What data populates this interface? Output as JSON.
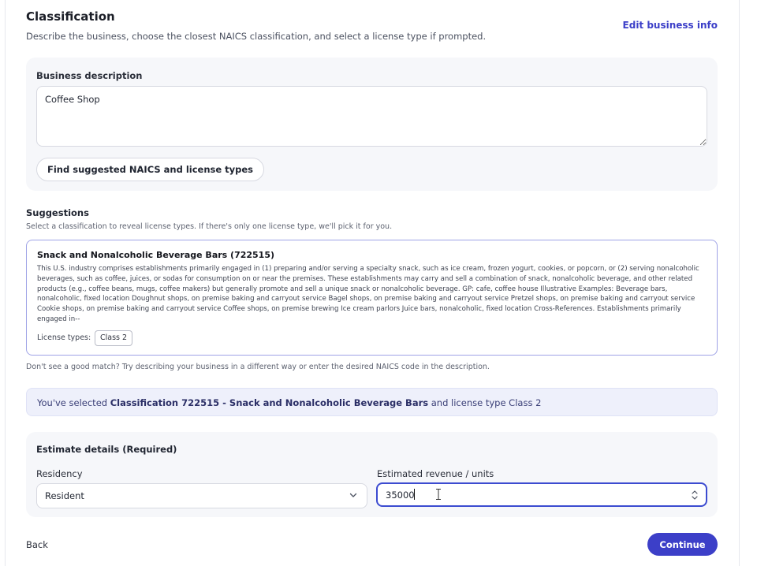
{
  "header": {
    "title": "Classification",
    "subtitle": "Describe the business, choose the closest NAICS classification, and select a license type if prompted.",
    "edit_link": "Edit business info"
  },
  "description": {
    "label": "Business description",
    "value": "Coffee Shop",
    "find_button": "Find suggested NAICS and license types"
  },
  "suggestions": {
    "title": "Suggestions",
    "hint": "Select a classification to reveal license types. If there's only one license type, we'll pick it for you.",
    "items": [
      {
        "name": "Snack and Nonalcoholic Beverage Bars (722515)",
        "description": "This U.S. industry comprises establishments primarily engaged in (1) preparing and/or serving a specialty snack, such as ice cream, frozen yogurt, cookies, or popcorn, or (2) serving nonalcoholic beverages, such as coffee, juices, or sodas for consumption on or near the premises. These establishments may carry and sell a combination of snack, nonalcoholic beverage, and other related products (e.g., coffee beans, mugs, coffee makers) but generally promote and sell a unique snack or nonalcoholic beverage. GP: cafe, coffee house Illustrative Examples: Beverage bars, nonalcoholic, fixed location Doughnut shops, on premise baking and carryout service Bagel shops, on premise baking and carryout service Pretzel shops, on premise baking and carryout service Cookie shops, on premise baking and carryout service Coffee shops, on premise brewing Ice cream parlors Juice bars, nonalcoholic, fixed location Cross-References. Establishments primarily engaged in--",
        "license_label": "License types:",
        "license_types": [
          "Class 2"
        ]
      }
    ],
    "no_match": "Don't see a good match? Try describing your business in a different way or enter the desired NAICS code in the description."
  },
  "selection": {
    "prefix": "You've selected ",
    "classification": "Classification 722515 - Snack and Nonalcoholic Beverage Bars",
    "suffix": " and license type Class 2"
  },
  "estimate": {
    "title": "Estimate details (Required)",
    "residency_label": "Residency",
    "residency_value": "Resident",
    "revenue_label": "Estimated revenue / units",
    "revenue_value": "35000"
  },
  "footer": {
    "back": "Back",
    "continue": "Continue"
  },
  "colors": {
    "accent": "#3c3fc8",
    "card_bg": "#f6f7fa",
    "banner_bg": "#eef0fb"
  }
}
